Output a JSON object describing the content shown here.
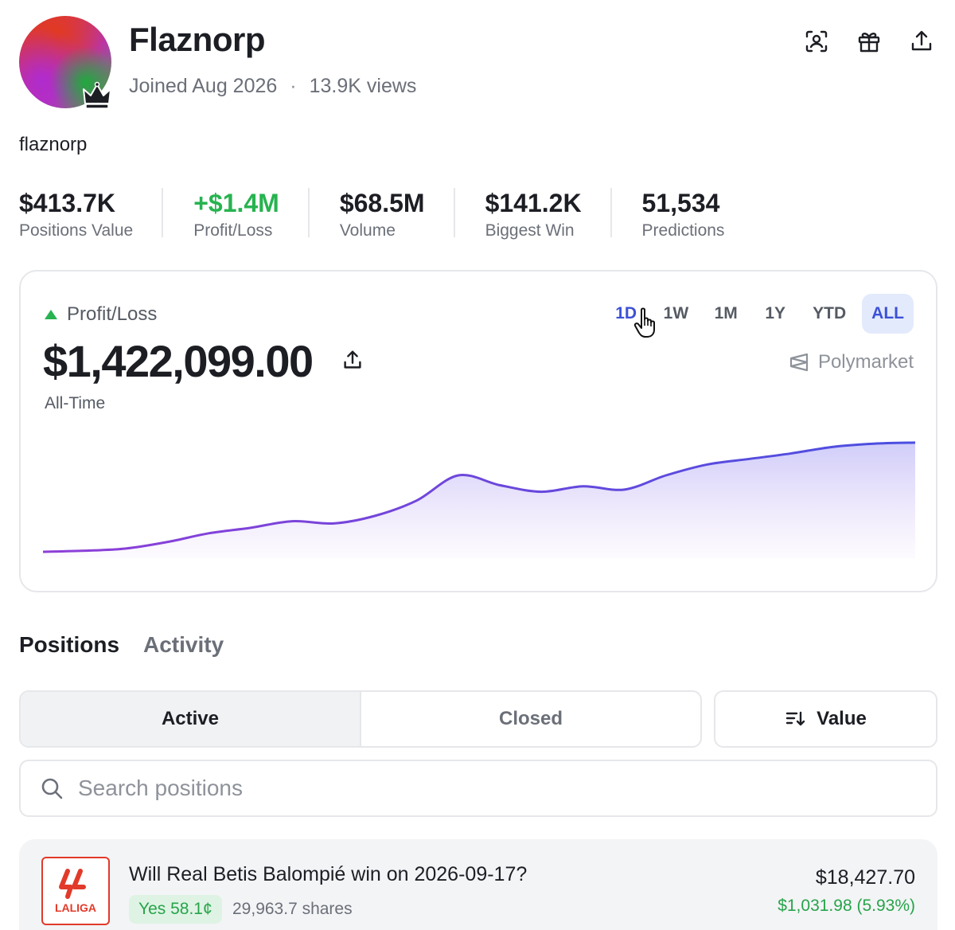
{
  "profile": {
    "name": "Flaznorp",
    "joined": "Joined Aug 2026",
    "separator": "·",
    "views": "13.9K views",
    "username": "flaznorp",
    "badge_icon": "crown-icon"
  },
  "header_actions": [
    {
      "name": "scan-profile-button",
      "icon": "scan-user-icon"
    },
    {
      "name": "gift-button",
      "icon": "gift-icon"
    },
    {
      "name": "share-button",
      "icon": "share-icon"
    }
  ],
  "stats": [
    {
      "value": "$413.7K",
      "label": "Positions Value"
    },
    {
      "value": "+$1.4M",
      "label": "Profit/Loss",
      "positive": true
    },
    {
      "value": "$68.5M",
      "label": "Volume"
    },
    {
      "value": "$141.2K",
      "label": "Biggest Win"
    },
    {
      "value": "51,534",
      "label": "Predictions"
    }
  ],
  "pnl_card": {
    "title": "Profit/Loss",
    "amount": "$1,422,099.00",
    "period": "All-Time",
    "brand": "Polymarket",
    "ranges": [
      "1D",
      "1W",
      "1M",
      "1Y",
      "YTD",
      "ALL"
    ],
    "active_range": "ALL",
    "hover_range": "1D",
    "colors": {
      "line_start": "#8e3fd8",
      "line_end": "#4a4fe0",
      "positive": "#27b350"
    }
  },
  "chart_data": {
    "type": "area",
    "x": [
      0,
      1,
      2,
      3,
      4,
      5,
      6,
      7,
      8,
      9,
      10,
      11,
      12,
      13,
      14,
      15,
      16,
      17,
      18,
      19,
      20,
      21
    ],
    "values": [
      0.0,
      0.01,
      0.03,
      0.09,
      0.17,
      0.22,
      0.28,
      0.26,
      0.33,
      0.47,
      0.7,
      0.61,
      0.55,
      0.6,
      0.57,
      0.7,
      0.8,
      0.85,
      0.9,
      0.96,
      0.99,
      1.0
    ],
    "ylim": [
      0,
      1.05
    ],
    "grid": false
  },
  "tabs": [
    "Positions",
    "Activity"
  ],
  "segments": [
    "Active",
    "Closed"
  ],
  "sort_label": "Value",
  "search": {
    "placeholder": "Search positions"
  },
  "positions": [
    {
      "logo_text": "LALIGA",
      "title": "Will Real Betis Balompié win on 2026-09-17?",
      "outcome": "Yes 58.1¢",
      "shares": "29,963.7 shares",
      "value": "$18,427.70",
      "pnl": "$1,031.98 (5.93%)"
    }
  ]
}
